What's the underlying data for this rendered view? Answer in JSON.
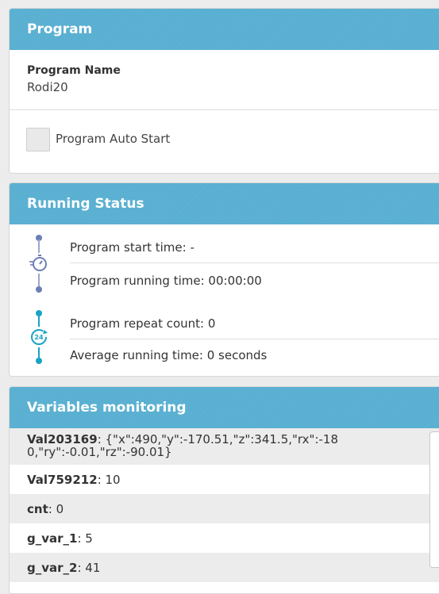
{
  "program": {
    "header": "Program",
    "name_label": "Program Name",
    "name_value": "Rodi20",
    "auto_start_label": "Program Auto Start"
  },
  "running_status": {
    "header": "Running Status",
    "start_time_label": "Program start time",
    "start_time_value": ": -",
    "running_time_label": "Program running time",
    "running_time_value": ":  00:00:00",
    "repeat_count_label": "Program repeat count",
    "repeat_count_value": ": 0",
    "avg_time_label": "Average running time",
    "avg_time_value": ": 0 seconds",
    "timer_icon_color": "#6b7fb5",
    "repeat_icon_color": "#1aa3c4"
  },
  "variables": {
    "header": "Variables monitoring",
    "items": [
      {
        "name": "Val203169",
        "value_line1": ": {\"x\":490,\"y\":-170.51,\"z\":341.5,\"rx\":-18",
        "value_line2": "0,\"ry\":-0.01,\"rz\":-90.01}"
      },
      {
        "name": "Val759212",
        "value": ": 10"
      },
      {
        "name": "cnt",
        "value": ": 0"
      },
      {
        "name": "g_var_1",
        "value": ": 5"
      },
      {
        "name": "g_var_2",
        "value": ": 41"
      }
    ]
  },
  "colors": {
    "header_bg": "#58afd1",
    "page_bg": "#ececec"
  }
}
